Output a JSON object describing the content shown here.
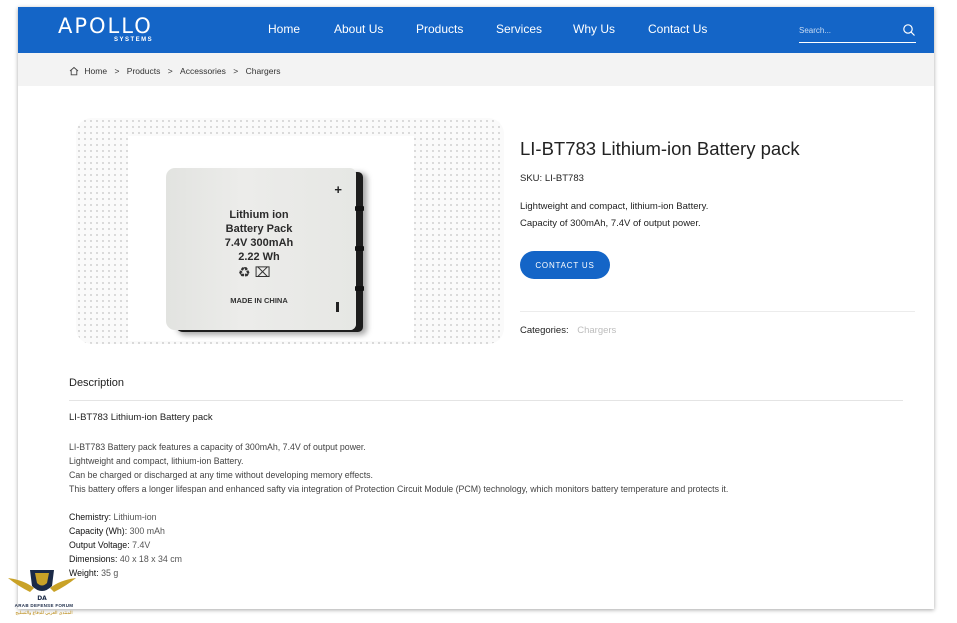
{
  "brand": {
    "name": "APOLLO",
    "tagline": "SYSTEMS"
  },
  "nav": {
    "items": [
      "Home",
      "About Us",
      "Products",
      "Services",
      "Why Us",
      "Contact Us"
    ]
  },
  "search": {
    "placeholder": "Search..."
  },
  "breadcrumb": [
    "Home",
    "Products",
    "Accessories",
    "Chargers"
  ],
  "product": {
    "title": "LI-BT783 Lithium-ion Battery pack",
    "sku_label": "SKU:",
    "sku": "LI-BT783",
    "short_description": [
      "Lightweight and compact, lithium-ion Battery.",
      "Capacity of 300mAh, 7.4V of output power."
    ],
    "contact_button": "CONTACT US",
    "categories_label": "Categories:",
    "category": "Chargers",
    "image_text": {
      "lines": [
        "Lithium ion",
        "Battery Pack",
        "7.4V 300mAh",
        "2.22 Wh"
      ],
      "symbols": "♻ ⌧",
      "made_in": "MADE IN CHINA",
      "plus": "+"
    }
  },
  "description": {
    "tab": "Description",
    "heading": "LI-BT783 Lithium-ion Battery pack",
    "paragraphs": [
      "LI-BT783 Battery pack features a capacity of 300mAh, 7.4V of output power.",
      "Lightweight and compact, lithium-ion Battery.",
      "Can be charged or discharged at any time without developing memory effects.",
      "This battery offers a longer lifespan and enhanced safty via integration of Protection Circuit Module (PCM) technology, which monitors battery temperature and protects it."
    ],
    "specs": [
      {
        "label": "Chemistry:",
        "value": "Lithium-ion"
      },
      {
        "label": "Capacity (Wh):",
        "value": "300 mAh"
      },
      {
        "label": "Output Voltage:",
        "value": "7.4V"
      },
      {
        "label": "Dimensions:",
        "value": "40 x 18 x 34 cm"
      },
      {
        "label": "Weight:",
        "value": "35 g"
      }
    ]
  },
  "watermark": {
    "badge": "DA",
    "name": "ARAB DEFENSE FORUM",
    "subtitle": "المنتدى العربي للدفاع والتسليح"
  },
  "colors": {
    "primary": "#1465c7",
    "breadcrumb_bg": "#f3f3f3",
    "muted_link": "#bdbdbd"
  }
}
